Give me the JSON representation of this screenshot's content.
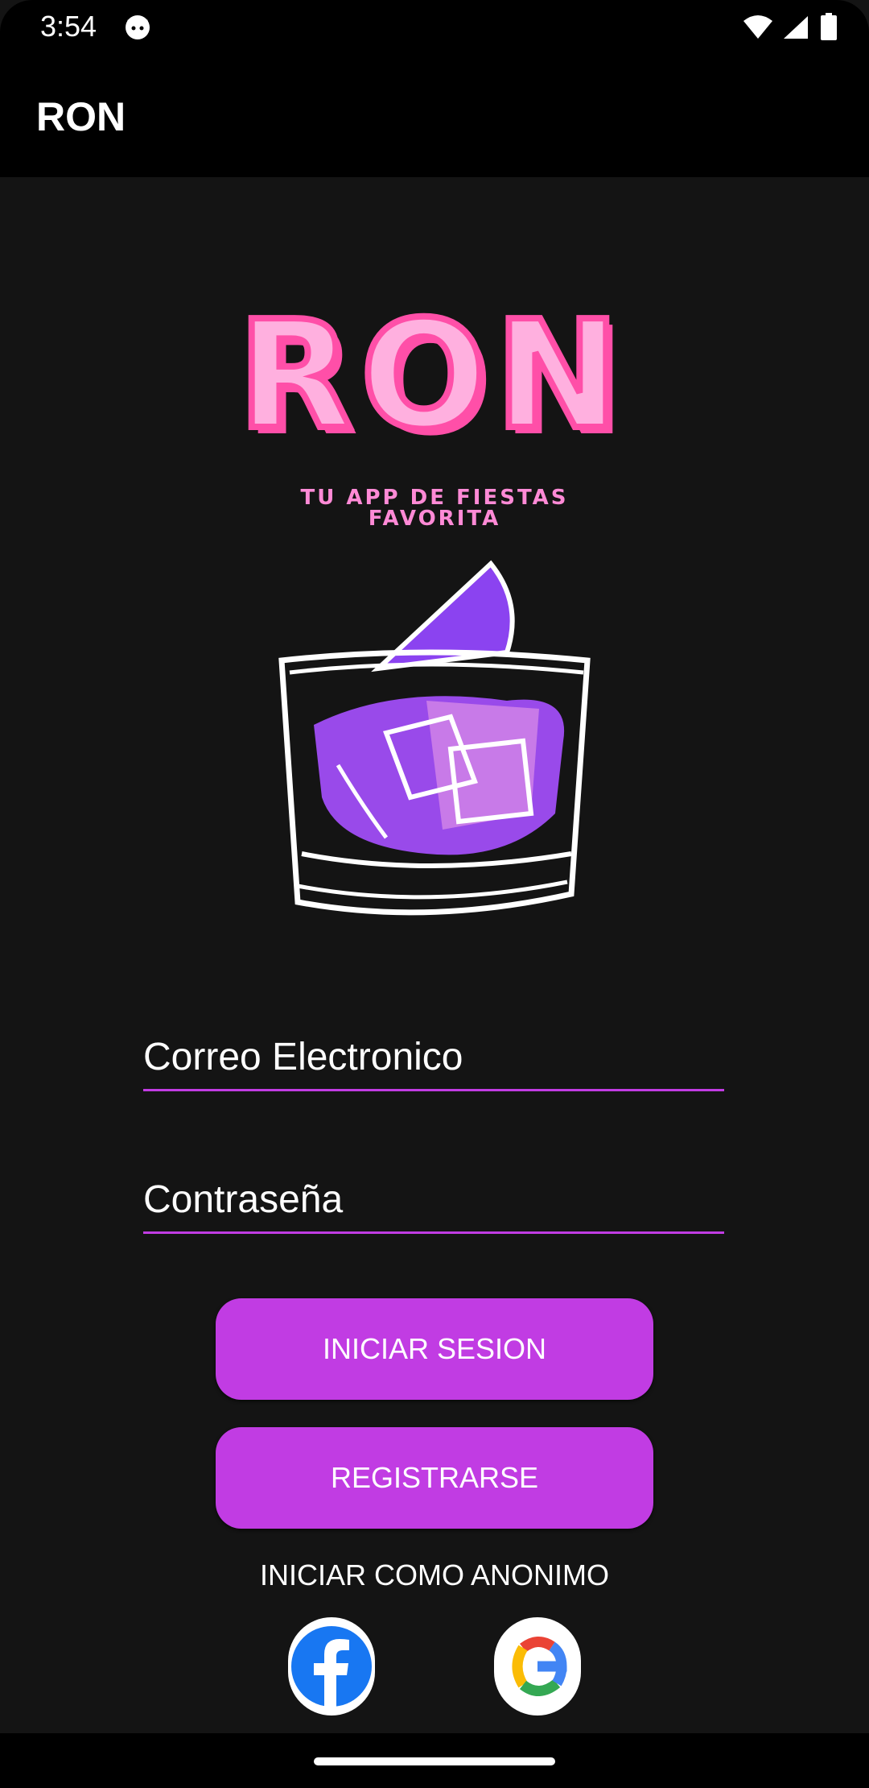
{
  "status_bar": {
    "time": "3:54"
  },
  "app_bar": {
    "title": "RON"
  },
  "logo": {
    "text": "RON",
    "tagline_line1": "TU APP DE FIESTAS",
    "tagline_line2": "FAVORITA"
  },
  "form": {
    "email_placeholder": "Correo Electronico",
    "password_placeholder": "Contraseña"
  },
  "buttons": {
    "login": "INICIAR SESION",
    "register": "REGISTRARSE",
    "anonymous": "INICIAR COMO ANONIMO"
  },
  "colors": {
    "accent": "#c13ce3",
    "logo_pink": "#ff9ad9",
    "background": "#141414"
  },
  "icons": [
    "cat-icon",
    "wifi-icon",
    "signal-icon",
    "battery-icon",
    "facebook-icon",
    "google-icon"
  ]
}
